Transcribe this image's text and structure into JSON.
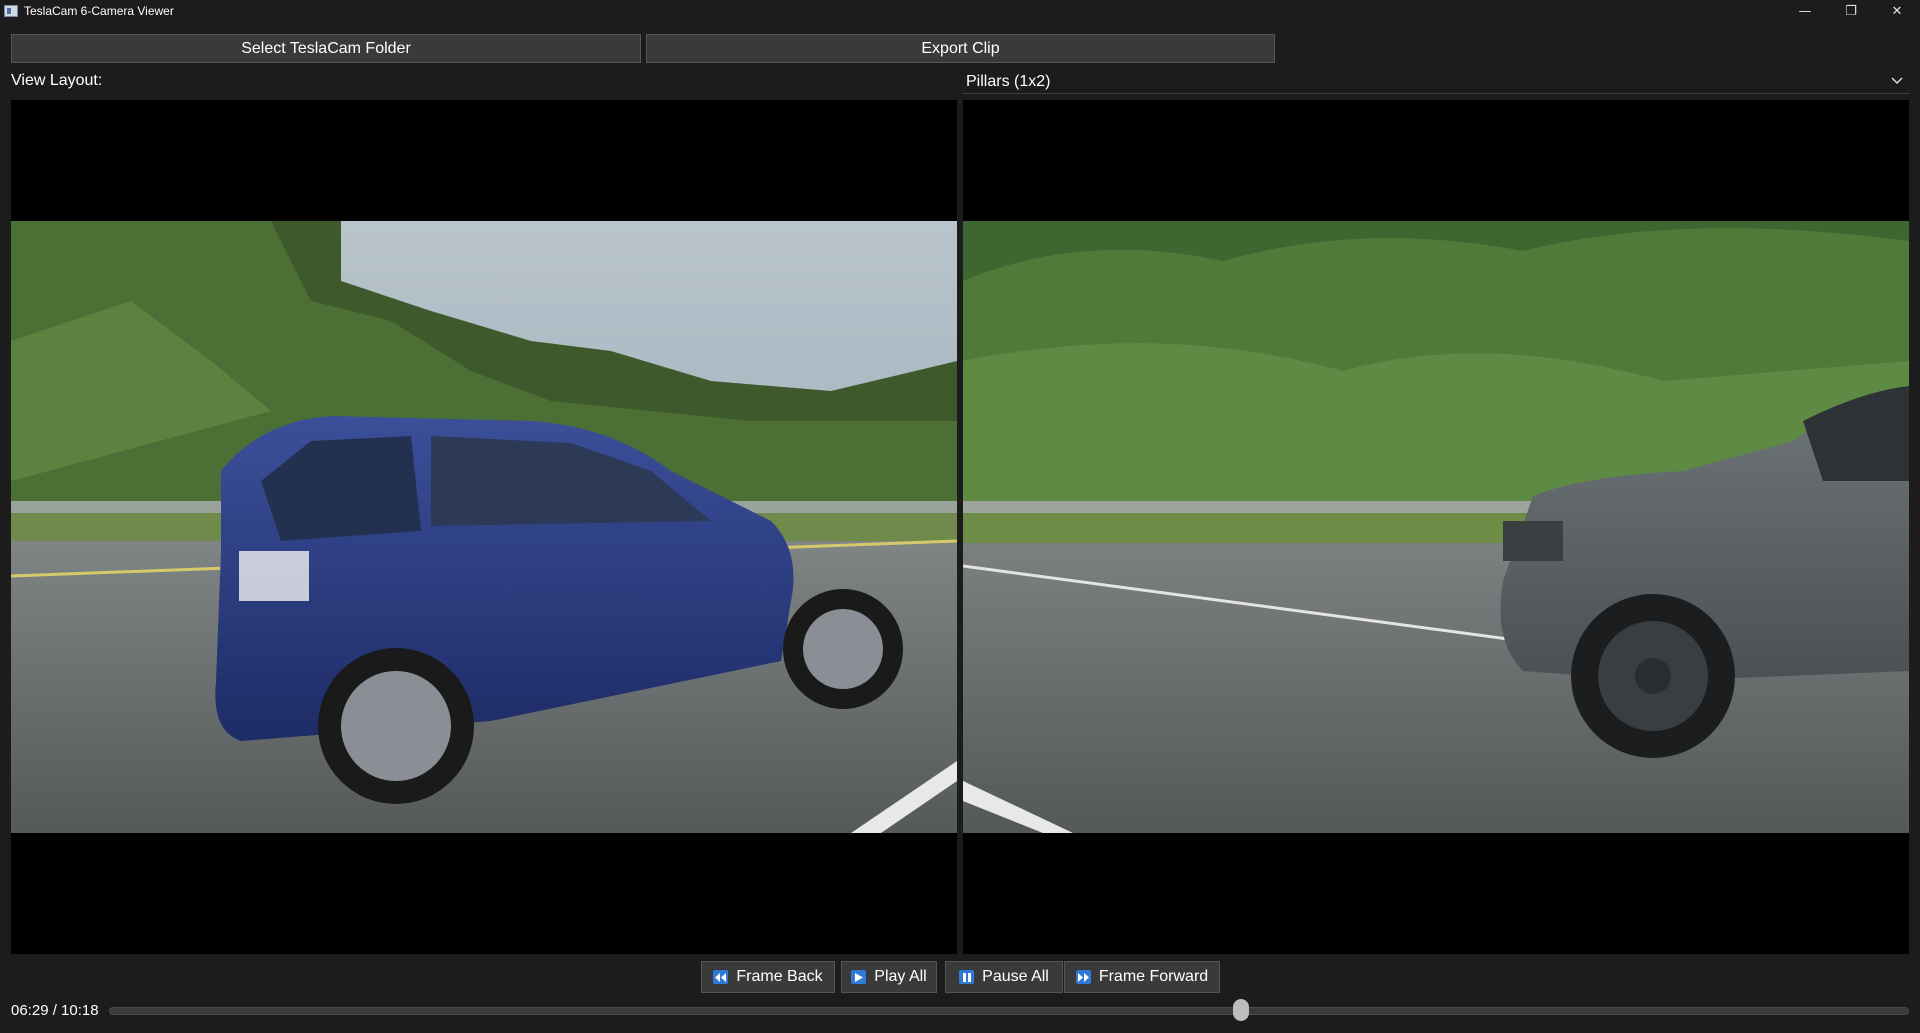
{
  "window": {
    "title": "TeslaCam 6-Camera Viewer",
    "minimize_glyph": "—",
    "restore_glyph": "❐",
    "close_glyph": "✕"
  },
  "toolbar": {
    "select_folder_label": "Select TeslaCam Folder",
    "export_clip_label": "Export Clip"
  },
  "layout": {
    "label": "View Layout:",
    "selected": "Pillars (1x2)"
  },
  "videos": [
    {
      "name": "left-pillar",
      "description_icon": "video-frame"
    },
    {
      "name": "right-pillar",
      "description_icon": "video-frame"
    }
  ],
  "controls": {
    "frame_back": {
      "label": "Frame Back",
      "icon": "rewind-icon"
    },
    "play_all": {
      "label": "Play All",
      "icon": "play-icon"
    },
    "pause_all": {
      "label": "Pause All",
      "icon": "pause-icon"
    },
    "frame_forward": {
      "label": "Frame Forward",
      "icon": "fast-forward-icon"
    }
  },
  "playback": {
    "time_display": "06:29 / 10:18",
    "position_fraction": 0.629
  },
  "colors": {
    "background": "#1c1c1c",
    "button": "#3a3a3a",
    "accent": "#2f7ad8"
  }
}
